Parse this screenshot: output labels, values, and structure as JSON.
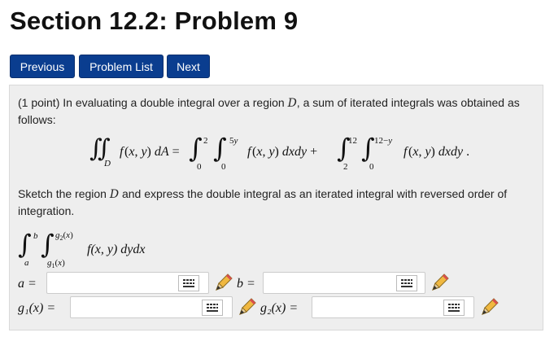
{
  "header": {
    "title": "Section 12.2: Problem 9"
  },
  "nav": {
    "previous_label": "Previous",
    "list_label": "Problem List",
    "next_label": "Next"
  },
  "problem": {
    "intro_points": "(1 point)",
    "intro_text": "In evaluating a double integral over a region",
    "region_var": "D",
    "intro_text2": ", a sum of iterated integrals was obtained as follows:",
    "sketch_text": "Sketch the region",
    "sketch_text2": "and express the double integral as an iterated integral with reversed order of integration.",
    "answer_integrand": "f(x, y) dydx",
    "labels": {
      "a": "a =",
      "b": "b =",
      "g1": "g₁(x) =",
      "g2": "g₂(x) ="
    },
    "inputs": {
      "a": "",
      "b": "",
      "g1": "",
      "g2": ""
    }
  },
  "icons": {
    "keyboard": "keyboard-icon",
    "pencil": "pencil-icon"
  }
}
